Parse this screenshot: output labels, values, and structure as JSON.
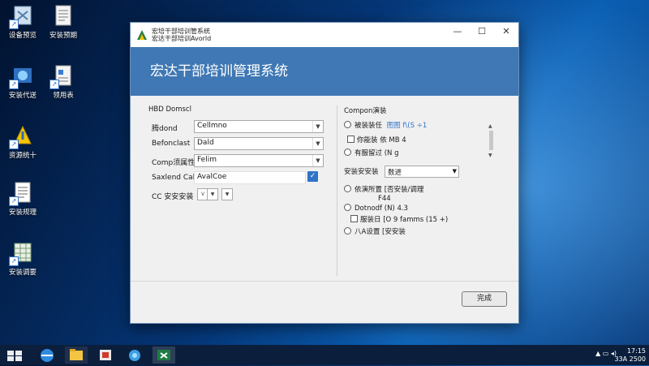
{
  "desktop": {
    "icons": [
      {
        "label": "设备预览"
      },
      {
        "label": "安装预期"
      },
      {
        "label": "安装代送"
      },
      {
        "label": "领用表"
      },
      {
        "label": "资源统十"
      },
      {
        "label": "安装规理"
      },
      {
        "label": "安装调要"
      }
    ]
  },
  "window": {
    "title_line1": "宏培干部培训管系统",
    "title_line2": "宏达干部培训Avorld",
    "controls": {
      "minimize": "—",
      "maximize": "☐",
      "close": "✕"
    },
    "header": "宏达干部培训管理系统",
    "left_group": {
      "title": "HBD Domscl",
      "rows": [
        {
          "label": "腾dond",
          "value": "Cellmno"
        },
        {
          "label": "Befonclast",
          "value": "Dald"
        },
        {
          "label": "Comp须属性",
          "value": "Felim"
        },
        {
          "label": "Saxlend Cal",
          "value": "AvalCoe",
          "checked": "✓"
        },
        {
          "label": "CC 安安安装",
          "value": "V"
        }
      ]
    },
    "right_group": {
      "title": "Compon演装",
      "items": [
        {
          "type": "radio",
          "text": "被装装任",
          "extra": "图图 f\\(S ÷1"
        },
        {
          "type": "check",
          "text": "你能装 依 MB 4"
        },
        {
          "type": "radio",
          "text": "有服留过 (N g"
        },
        {
          "type": "combo",
          "text": "安装安安装",
          "value": "数进"
        },
        {
          "type": "radio",
          "text": "依演所置 [否安装/调理",
          "extra": "F44"
        },
        {
          "type": "radio",
          "text": "Dotnodf (N) 4.3"
        },
        {
          "type": "check",
          "text": "服装日 [O 9 famms (15 +)"
        },
        {
          "type": "radio",
          "text": "八A设置 [安安装"
        }
      ]
    },
    "ok_button": "完成"
  },
  "taskbar": {
    "tray_text": "▲ ▭ ◂)",
    "clock_time": "17:15",
    "clock_date": "33A 2500"
  },
  "colors": {
    "header_band": "#3f78b4",
    "checkbox_accent": "#2f73c7",
    "taskbar": "#0b1f3d"
  }
}
